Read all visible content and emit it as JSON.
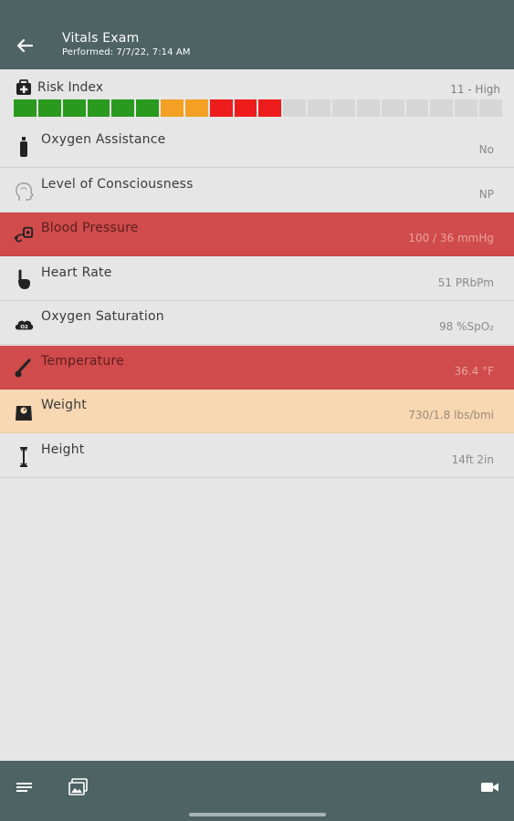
{
  "header": {
    "title": "Vitals Exam",
    "subtitle": "Performed: 7/7/22, 7:14 AM"
  },
  "risk": {
    "label": "Risk Index",
    "value": "11 - High",
    "score": 11,
    "segments_total": 20,
    "segment_colors": [
      "#2a9a1e",
      "#2a9a1e",
      "#2a9a1e",
      "#2a9a1e",
      "#2a9a1e",
      "#2a9a1e",
      "#f3a024",
      "#f3a024",
      "#ee1c1c",
      "#ee1c1c",
      "#ee1c1c",
      "#d6d6d6",
      "#d6d6d6",
      "#d6d6d6",
      "#d6d6d6",
      "#d6d6d6",
      "#d6d6d6",
      "#d6d6d6",
      "#d6d6d6",
      "#d6d6d6"
    ]
  },
  "vitals": [
    {
      "label": "Oxygen Assistance",
      "value": "No",
      "icon": "oxygen-tank-icon",
      "status": "normal"
    },
    {
      "label": "Level of Consciousness",
      "value": "NP",
      "icon": "head-profile-icon",
      "status": "normal"
    },
    {
      "label": "Blood Pressure",
      "value": "100 / 36 mmHg",
      "icon": "blood-pressure-cuff-icon",
      "status": "red"
    },
    {
      "label": "Heart Rate",
      "value": "51 PRbPm",
      "icon": "pulse-finger-icon",
      "status": "normal"
    },
    {
      "label": "Oxygen Saturation",
      "value": "98 %SpO₂",
      "icon": "o2-cloud-icon",
      "status": "normal"
    },
    {
      "label": "Temperature",
      "value": "36.4 °F",
      "icon": "thermometer-icon",
      "status": "red"
    },
    {
      "label": "Weight",
      "value": "730/1.8 lbs/bmi",
      "icon": "scale-icon",
      "status": "orange"
    },
    {
      "label": "Height",
      "value": "14ft 2in",
      "icon": "height-icon",
      "status": "normal"
    }
  ],
  "colors": {
    "bar": "#4e6364",
    "alert_red": "#d04b4b",
    "alert_orange": "#f8d8b3"
  },
  "bottom_bar": {
    "icons": [
      "list-icon",
      "gallery-icon",
      "video-camera-icon"
    ]
  }
}
